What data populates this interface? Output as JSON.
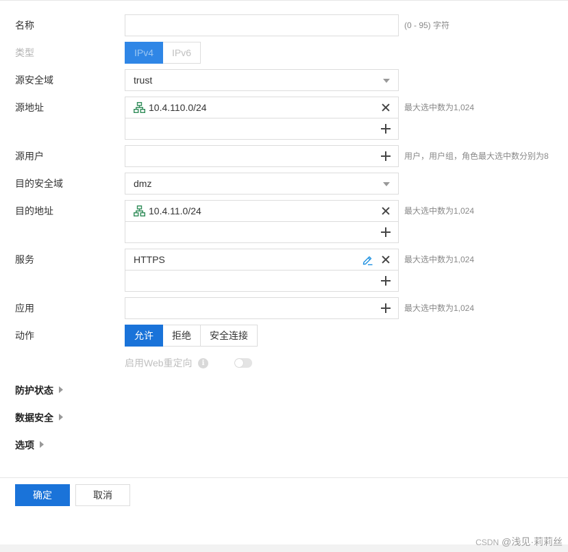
{
  "form": {
    "name": {
      "label": "名称",
      "value": "",
      "hint": "(0 - 95) 字符"
    },
    "type": {
      "label": "类型",
      "options": [
        "IPv4",
        "IPv6"
      ],
      "selected": "IPv4"
    },
    "src_zone": {
      "label": "源安全域",
      "value": "trust"
    },
    "src_addr": {
      "label": "源地址",
      "items": [
        "10.4.110.0/24"
      ],
      "hint": "最大选中数为1,024"
    },
    "src_user": {
      "label": "源用户",
      "hint": "用户，用户组，角色最大选中数分别为8"
    },
    "dst_zone": {
      "label": "目的安全域",
      "value": "dmz"
    },
    "dst_addr": {
      "label": "目的地址",
      "items": [
        "10.4.11.0/24"
      ],
      "hint": "最大选中数为1,024"
    },
    "service": {
      "label": "服务",
      "items": [
        "HTTPS"
      ],
      "hint": "最大选中数为1,024"
    },
    "app": {
      "label": "应用",
      "hint": "最大选中数为1,024"
    },
    "action": {
      "label": "动作",
      "options": [
        "允许",
        "拒绝",
        "安全连接"
      ],
      "selected": "允许"
    },
    "web_redirect": {
      "label": "启用Web重定向",
      "enabled": false
    }
  },
  "sections": [
    {
      "label": "防护状态"
    },
    {
      "label": "数据安全"
    },
    {
      "label": "选项"
    }
  ],
  "footer": {
    "confirm": "确定",
    "cancel": "取消"
  },
  "watermark": {
    "source": "CSDN",
    "author": "@浅见·莉莉丝"
  },
  "colors": {
    "primary": "#1a73d9",
    "icon_green": "#2e8b57",
    "icon_blue": "#1a8fe0"
  }
}
